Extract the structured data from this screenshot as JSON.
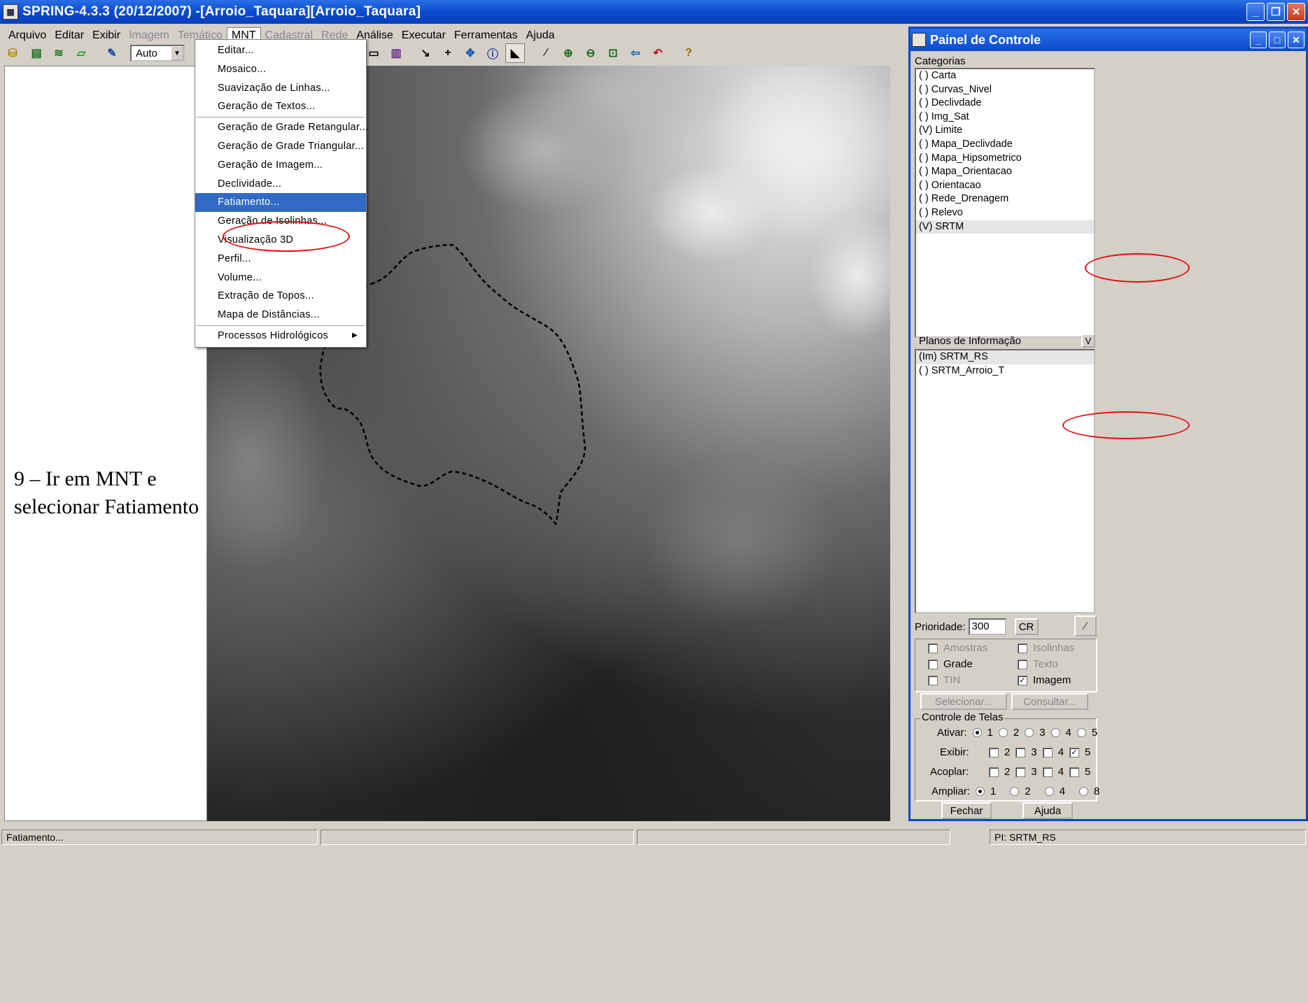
{
  "window": {
    "title": "SPRING-4.3.3 (20/12/2007) -[Arroio_Taquara][Arroio_Taquara]",
    "icon": "spring-app-icon",
    "controls": [
      "minimize",
      "restore",
      "close"
    ]
  },
  "menubar": {
    "items": [
      {
        "label": "Arquivo",
        "enabled": true
      },
      {
        "label": "Editar",
        "enabled": true
      },
      {
        "label": "Exibir",
        "enabled": true
      },
      {
        "label": "Imagem",
        "enabled": false
      },
      {
        "label": "Temático",
        "enabled": false
      },
      {
        "label": "MNT",
        "enabled": true,
        "active": true
      },
      {
        "label": "Cadastral",
        "enabled": false
      },
      {
        "label": "Rede",
        "enabled": false
      },
      {
        "label": "Análise",
        "enabled": true
      },
      {
        "label": "Executar",
        "enabled": true
      },
      {
        "label": "Ferramentas",
        "enabled": true
      },
      {
        "label": "Ajuda",
        "enabled": true
      }
    ]
  },
  "toolbar": {
    "zoom_value": "Auto",
    "help_glyph": "?"
  },
  "mnt_menu": {
    "items": [
      {
        "label": "Editar..."
      },
      {
        "label": "Mosaico..."
      },
      {
        "label": "Suavização de Linhas..."
      },
      {
        "label": "Geração de Textos..."
      },
      {
        "separator": true
      },
      {
        "label": "Geração de Grade Retangular..."
      },
      {
        "label": "Geração de Grade Triangular..."
      },
      {
        "label": "Geração de Imagem..."
      },
      {
        "label": "Declividade..."
      },
      {
        "label": "Fatiamento...",
        "highlighted": true
      },
      {
        "label": "Geração de Isolinhas..."
      },
      {
        "label": "Visualização 3D"
      },
      {
        "label": "Perfil..."
      },
      {
        "label": "Volume..."
      },
      {
        "label": "Extração de Topos..."
      },
      {
        "label": "Mapa de Distâncias..."
      },
      {
        "separator": true
      },
      {
        "label": "Processos Hidrológicos",
        "submenu": true
      }
    ]
  },
  "instruction": {
    "line1": "9 – Ir em MNT e",
    "line2": "selecionar Fatiamento"
  },
  "control_panel": {
    "title": "Painel de Controle",
    "categories_label": "Categorias",
    "categories": [
      {
        "label": "( ) Carta"
      },
      {
        "label": "( ) Curvas_Nivel"
      },
      {
        "label": "( ) Declivdade"
      },
      {
        "label": "( ) Img_Sat"
      },
      {
        "label": "(V) Limite"
      },
      {
        "label": "( ) Mapa_Declivdade"
      },
      {
        "label": "( ) Mapa_Hipsometrico"
      },
      {
        "label": "( ) Mapa_Orientacao"
      },
      {
        "label": "( ) Orientacao"
      },
      {
        "label": "( ) Rede_Drenagem"
      },
      {
        "label": "( ) Relevo"
      },
      {
        "label": "(V) SRTM",
        "selected": true
      }
    ],
    "planos_label": "Planos de Informação",
    "planos_toggle": "V",
    "planos": [
      {
        "label": "(Im) SRTM_RS",
        "selected": true
      },
      {
        "label": "( ) SRTM_Arroio_T"
      }
    ],
    "prioridade_label": "Prioridade:",
    "prioridade_value": "300",
    "cr_button": "CR",
    "display_options": [
      {
        "label": "Amostras",
        "checked": false,
        "enabled": false
      },
      {
        "label": "Isolinhas",
        "checked": false,
        "enabled": false
      },
      {
        "label": "Grade",
        "checked": false,
        "enabled": true
      },
      {
        "label": "Texto",
        "checked": false,
        "enabled": false
      },
      {
        "label": "TIN",
        "checked": false,
        "enabled": false
      },
      {
        "label": "Imagem",
        "checked": true,
        "enabled": true
      }
    ],
    "selecionar_button": "Selecionar...",
    "consultar_button": "Consultar...",
    "controle_telas": {
      "label": "Controle de Telas",
      "ativar_label": "Ativar:",
      "ativar_options": [
        "1",
        "2",
        "3",
        "4",
        "5"
      ],
      "ativar_selected": "1",
      "exibir_label": "Exibir:",
      "exibir_options": [
        "2",
        "3",
        "4",
        "5"
      ],
      "exibir_checked": [
        "5"
      ],
      "acoplar_label": "Acoplar:",
      "acoplar_options": [
        "2",
        "3",
        "4",
        "5"
      ],
      "ampliar_label": "Ampliar:",
      "ampliar_options": [
        "1",
        "2",
        "4",
        "8"
      ],
      "ampliar_selected": "1"
    },
    "fechar_button": "Fechar",
    "ajuda_button": "Ajuda"
  },
  "statusbar": {
    "message": "Fatiamento...",
    "plano": "PI: SRTM_RS"
  },
  "colors": {
    "title_blue": "#0a4bd0",
    "menu_highlight": "#316ac5",
    "annotation_red": "#e01010"
  }
}
